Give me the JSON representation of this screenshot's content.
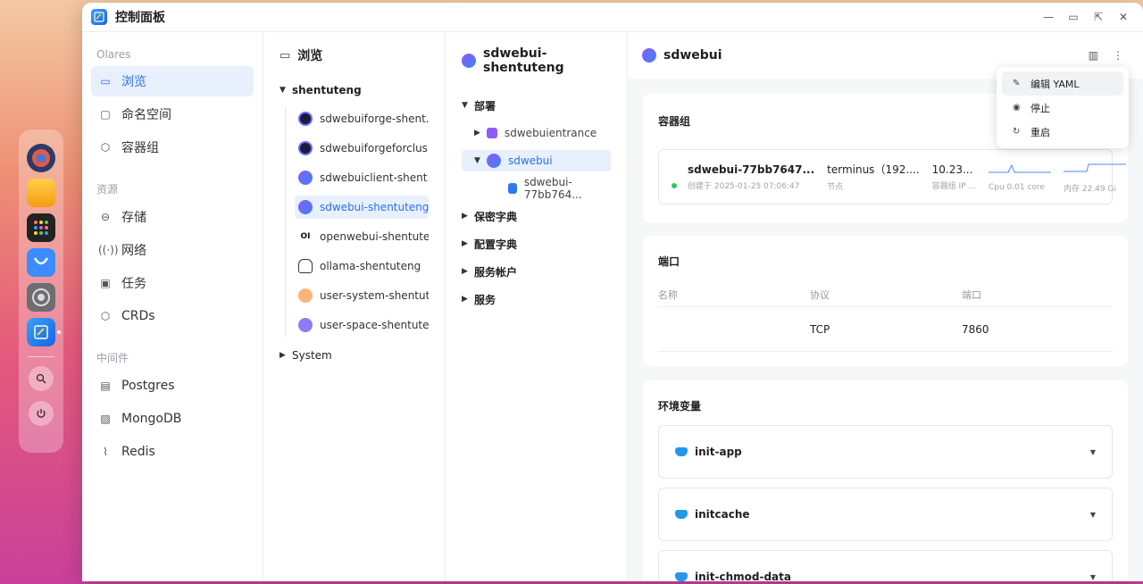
{
  "window": {
    "title": "控制面板"
  },
  "sidebar": {
    "sections": [
      {
        "label": "Olares",
        "items": [
          {
            "label": "浏览",
            "icon": "monitor-icon",
            "active": true
          },
          {
            "label": "命名空间",
            "icon": "namespace-icon"
          },
          {
            "label": "容器组",
            "icon": "cube-icon"
          }
        ]
      },
      {
        "label": "资源",
        "items": [
          {
            "label": "存储",
            "icon": "storage-icon"
          },
          {
            "label": "网络",
            "icon": "network-icon"
          },
          {
            "label": "任务",
            "icon": "briefcase-icon"
          },
          {
            "label": "CRDs",
            "icon": "cube-icon"
          }
        ]
      },
      {
        "label": "中间件",
        "items": [
          {
            "label": "Postgres",
            "icon": "chart-icon"
          },
          {
            "label": "MongoDB",
            "icon": "image-icon"
          },
          {
            "label": "Redis",
            "icon": "pulse-icon"
          }
        ]
      }
    ]
  },
  "browse": {
    "title": "浏览",
    "root": "shentuteng",
    "namespaces": [
      "sdwebuiforge-shent...",
      "sdwebuiforgeforclus...",
      "sdwebuiclient-shent...",
      "sdwebui-shentuteng",
      "openwebui-shentute...",
      "ollama-shentuteng",
      "user-system-shentut...",
      "user-space-shentute..."
    ],
    "ns_badge_ol": "OI",
    "system": "System"
  },
  "restree": {
    "title": "sdwebui-shentuteng",
    "deploy_label": "部署",
    "deploy_children": [
      "sdwebuientrance",
      "sdwebui"
    ],
    "pod": "sdwebui-77bb764...",
    "others": [
      "保密字典",
      "配置字典",
      "服务帐户",
      "服务"
    ]
  },
  "detail": {
    "title": "sdwebui",
    "pods_card": {
      "title": "容器组",
      "pod_name": "sdwebui-77bb7647...",
      "created": "创建于 2025-01-25 07:06:47",
      "node": "terminus（192....",
      "node_label": "节点",
      "ip": "10.23...",
      "ip_label": "容器组 IP ...",
      "cpu_label": "Cpu 0.01 core",
      "mem_label": "内存 22.49 Gi"
    },
    "ports_card": {
      "title": "端口",
      "headers": [
        "名称",
        "协议",
        "端口"
      ],
      "rows": [
        [
          "",
          "TCP",
          "7860"
        ]
      ]
    },
    "env_card": {
      "title": "环境变量",
      "items": [
        "init-app",
        "initcache",
        "init-chmod-data"
      ]
    }
  },
  "menu": {
    "items": [
      "编辑 YAML",
      "停止",
      "重启"
    ]
  },
  "colors": {
    "accent": "#2a6ff0",
    "ok": "#32c26b"
  }
}
